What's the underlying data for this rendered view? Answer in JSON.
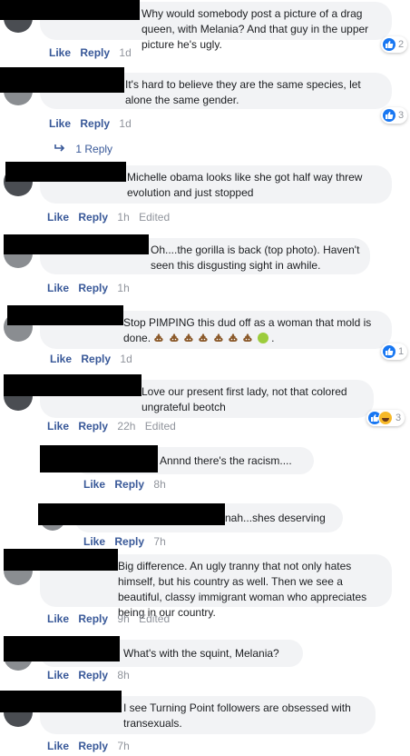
{
  "actions": {
    "like": "Like",
    "reply": "Reply",
    "edited": "Edited"
  },
  "comments": [
    {
      "text": "Why would somebody post a picture of a drag queen, with Melania? And that guy in the upper picture he's ugly.",
      "time": "1d",
      "reactions": "2"
    },
    {
      "text": "It's hard to believe they are the same species, let alone the same gender.",
      "time": "1d",
      "reactions": "3",
      "replies_link": "1 Reply"
    },
    {
      "text": "Michelle obama looks like she got half way threw evolution and just stopped",
      "time": "1h"
    },
    {
      "text": "Oh....the gorilla is back (top photo). Haven't seen this disgusting sight in awhile.",
      "time": "1h"
    },
    {
      "text_before": "Stop PIMPING this dud off as a woman that mold is done.",
      "text_after": ".",
      "time": "1d",
      "reactions": "1"
    },
    {
      "text": "Love our present first lady, not that colored ungrateful beotch",
      "time": "22h",
      "reactions": "3"
    },
    {
      "text": "Annnd there's the racism....",
      "time": "8h"
    },
    {
      "text": "nah...shes deserving",
      "time": "7h"
    },
    {
      "text": "Big difference. An ugly tranny that not only hates himself, but his country as well. Then we see a beautiful, classy immigrant woman who appreciates being in our country.",
      "time": "9h"
    },
    {
      "text": "What's with the squint, Melania?",
      "time": "8h"
    },
    {
      "text": "I see Turning Point followers are obsessed with transexuals.",
      "time": "7h"
    }
  ]
}
